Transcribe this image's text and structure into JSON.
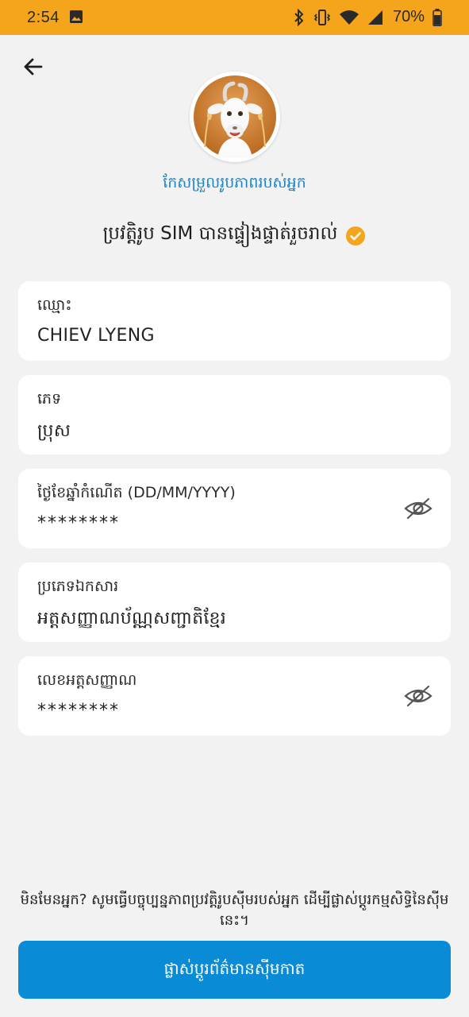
{
  "status_bar": {
    "time": "2:54",
    "battery": "70%"
  },
  "header": {
    "edit_photo_label": "កែសម្រួលរូបភាពរបស់អ្នក",
    "verified_text": "ប្រវត្តិរូប SIM បានផ្ទៀងផ្ទាត់រួចរាល់"
  },
  "fields": [
    {
      "label": "ឈ្មោះ",
      "value": "CHIEV LYENG"
    },
    {
      "label": "ភេទ",
      "value": "ប្រុស"
    },
    {
      "label": "ថ្ងៃខែឆ្នាំកំណើត (DD/MM/YYYY)",
      "value": "********"
    },
    {
      "label": "ប្រភេទឯកសារ",
      "value": "អត្តសញ្ញាណប័ណ្ណសញ្ជាតិខ្មែរ"
    },
    {
      "label": "លេខអត្តសញ្ញាណ",
      "value": "********"
    }
  ],
  "footer": {
    "notice": "មិនមែនអ្នក? សូមធ្វើបច្ចុប្បន្នភាពប្រវត្តិរូបស៊ីមរបស់អ្នក ដើម្បីផ្លាស់ប្តូរកម្មសិទ្ធិនៃស៊ីមនេះ។",
    "button_label": "ផ្លាស់ប្តូរព័ត៌មានស៊ីមកាត"
  },
  "colors": {
    "status_bar": "#f5a51c",
    "accent_blue": "#0a8bd6",
    "link_blue": "#1a86c7",
    "verified_orange": "#f5a51c",
    "background": "#f2f2f2"
  },
  "icons": {
    "back": "arrow-left-icon",
    "verified": "check-circle-icon",
    "reveal": "eye-off-icon"
  }
}
